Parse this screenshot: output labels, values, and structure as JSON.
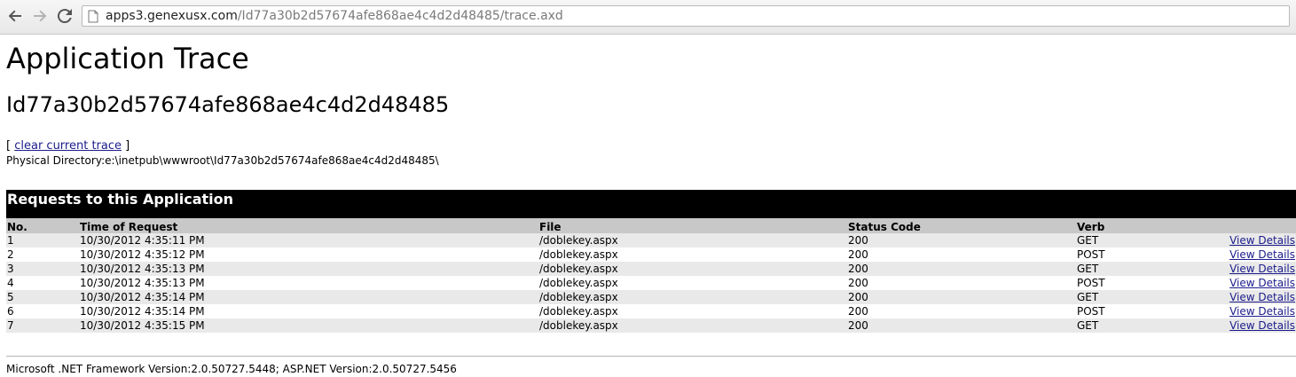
{
  "browser": {
    "url_host": "apps3.genexusx.com",
    "url_path": "/Id77a30b2d57674afe868ae4c4d2d48485/trace.axd"
  },
  "page": {
    "title": "Application Trace",
    "app_id": "Id77a30b2d57674afe868ae4c4d2d48485",
    "clear_prefix": "[",
    "clear_link": "clear current trace",
    "clear_suffix": "]",
    "physical_directory": "Physical Directory:e:\\inetpub\\wwwroot\\Id77a30b2d57674afe868ae4c4d2d48485\\"
  },
  "requests": {
    "title": "Requests to this Application",
    "columns": [
      "No.",
      "Time of Request",
      "File",
      "Status Code",
      "Verb"
    ],
    "rows": [
      {
        "no": "1",
        "time": "10/30/2012 4:35:11 PM",
        "file": "/doblekey.aspx",
        "status": "200",
        "verb": "GET",
        "details": "View Details"
      },
      {
        "no": "2",
        "time": "10/30/2012 4:35:12 PM",
        "file": "/doblekey.aspx",
        "status": "200",
        "verb": "POST",
        "details": "View Details"
      },
      {
        "no": "3",
        "time": "10/30/2012 4:35:13 PM",
        "file": "/doblekey.aspx",
        "status": "200",
        "verb": "GET",
        "details": "View Details"
      },
      {
        "no": "4",
        "time": "10/30/2012 4:35:13 PM",
        "file": "/doblekey.aspx",
        "status": "200",
        "verb": "POST",
        "details": "View Details"
      },
      {
        "no": "5",
        "time": "10/30/2012 4:35:14 PM",
        "file": "/doblekey.aspx",
        "status": "200",
        "verb": "GET",
        "details": "View Details"
      },
      {
        "no": "6",
        "time": "10/30/2012 4:35:14 PM",
        "file": "/doblekey.aspx",
        "status": "200",
        "verb": "POST",
        "details": "View Details"
      },
      {
        "no": "7",
        "time": "10/30/2012 4:35:15 PM",
        "file": "/doblekey.aspx",
        "status": "200",
        "verb": "GET",
        "details": "View Details"
      }
    ]
  },
  "footer": {
    "text": "Microsoft .NET Framework Version:2.0.50727.5448; ASP.NET Version:2.0.50727.5456"
  },
  "icons": {
    "back": "back-arrow-icon",
    "forward": "forward-arrow-icon",
    "reload": "reload-icon",
    "page": "page-icon"
  }
}
